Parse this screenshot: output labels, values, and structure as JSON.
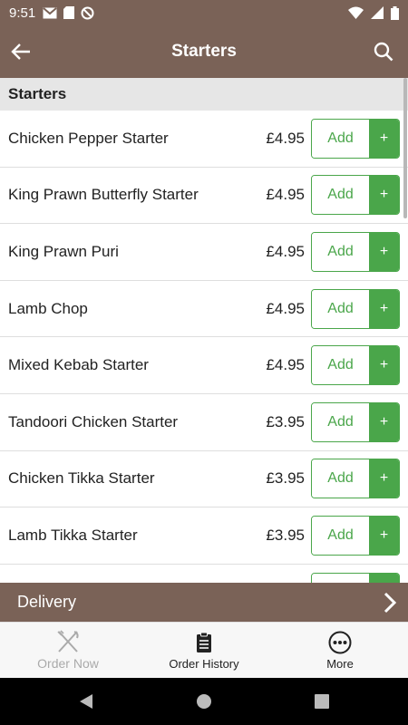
{
  "status_bar": {
    "time": "9:51"
  },
  "app_bar": {
    "title": "Starters"
  },
  "section": {
    "title": "Starters"
  },
  "items": [
    {
      "name": "Chicken Pepper Starter",
      "price": "£4.95",
      "add_label": "Add",
      "plus": "+"
    },
    {
      "name": "King Prawn Butterfly Starter",
      "price": "£4.95",
      "add_label": "Add",
      "plus": "+"
    },
    {
      "name": "King Prawn Puri",
      "price": "£4.95",
      "add_label": "Add",
      "plus": "+"
    },
    {
      "name": "Lamb Chop",
      "price": "£4.95",
      "add_label": "Add",
      "plus": "+"
    },
    {
      "name": "Mixed Kebab Starter",
      "price": "£4.95",
      "add_label": "Add",
      "plus": "+"
    },
    {
      "name": "Tandoori Chicken Starter",
      "price": "£3.95",
      "add_label": "Add",
      "plus": "+"
    },
    {
      "name": "Chicken Tikka Starter",
      "price": "£3.95",
      "add_label": "Add",
      "plus": "+"
    },
    {
      "name": "Lamb Tikka Starter",
      "price": "£3.95",
      "add_label": "Add",
      "plus": "+"
    },
    {
      "name": "",
      "price": "",
      "add_label": "",
      "plus": ""
    }
  ],
  "delivery_bar": {
    "label": "Delivery"
  },
  "bottom_nav": {
    "order_now": "Order Now",
    "order_history": "Order History",
    "more": "More"
  },
  "colors": {
    "brand": "#7a6257",
    "accent_green": "#4aa64a"
  }
}
